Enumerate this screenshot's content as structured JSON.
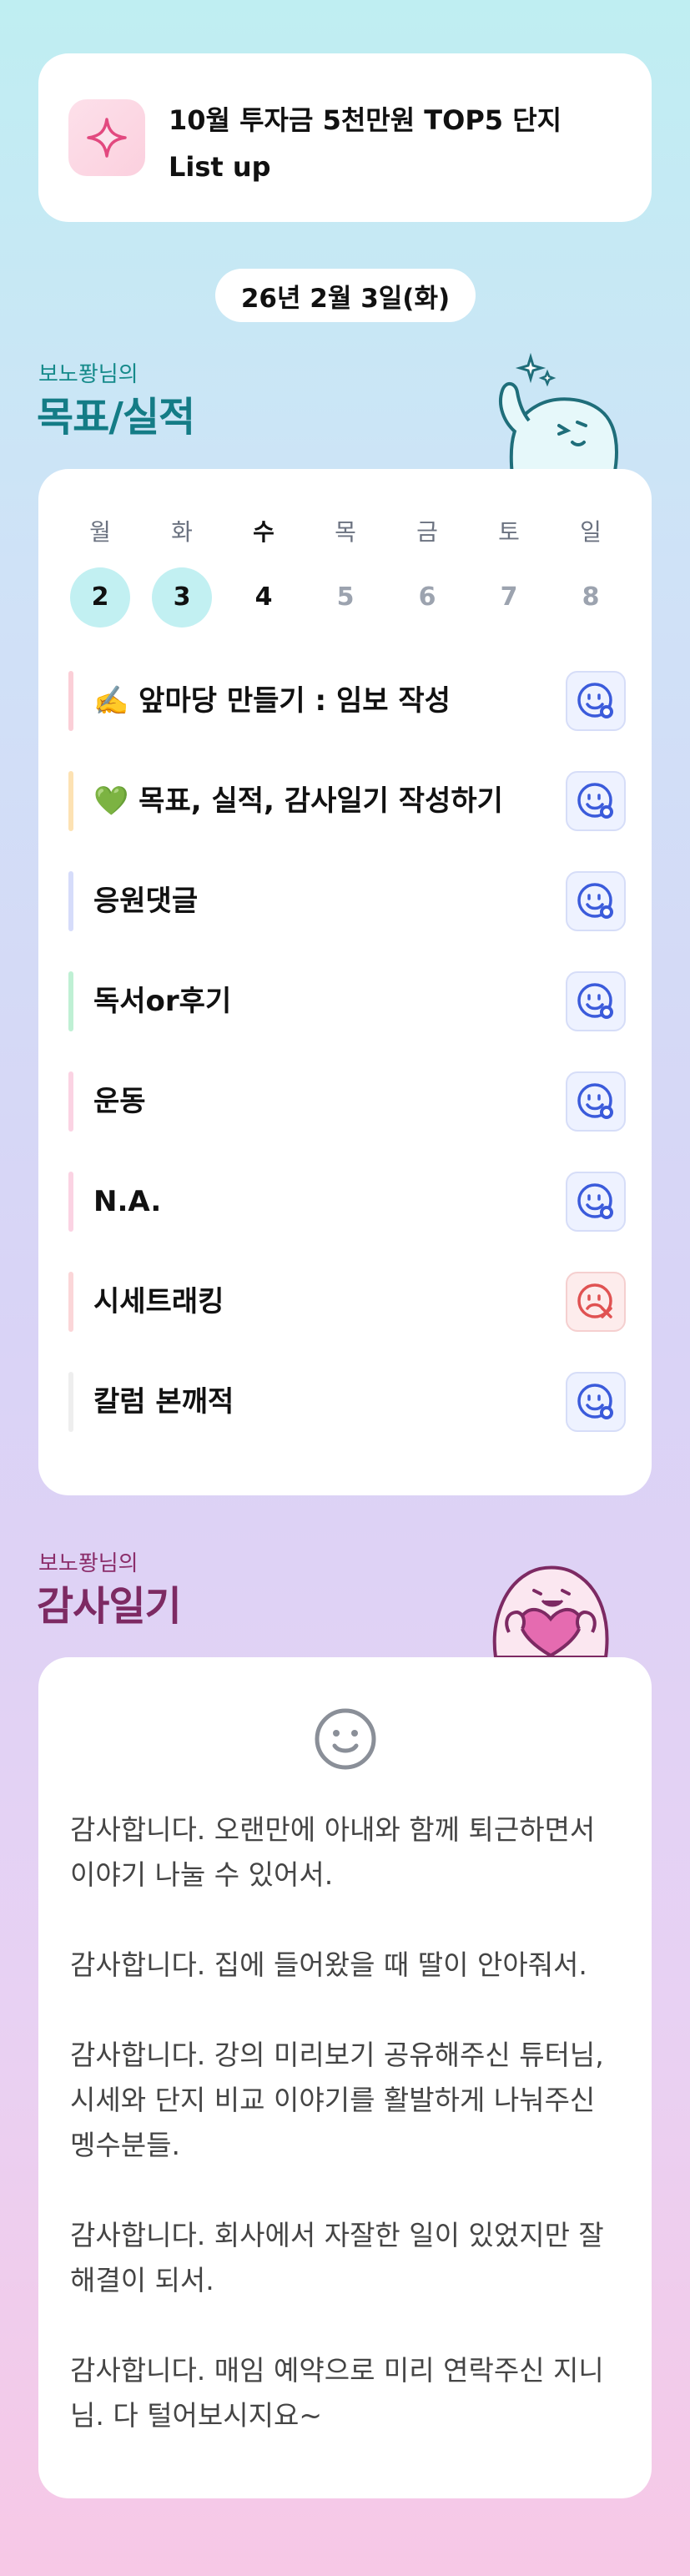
{
  "banner": {
    "title": "10월 투자금 5천만원 TOP5 단지\nList up",
    "icon": "sparkle-icon"
  },
  "date": "26년 2월 3일(화)",
  "goals_section": {
    "subtitle": "보노퐝님의",
    "title": "목표/실적"
  },
  "week": [
    {
      "name": "월",
      "num": "2",
      "state": "done"
    },
    {
      "name": "화",
      "num": "3",
      "state": "done"
    },
    {
      "name": "수",
      "num": "4",
      "state": "today"
    },
    {
      "name": "목",
      "num": "5",
      "state": "future"
    },
    {
      "name": "금",
      "num": "6",
      "state": "future"
    },
    {
      "name": "토",
      "num": "7",
      "state": "future"
    },
    {
      "name": "일",
      "num": "8",
      "state": "future"
    }
  ],
  "tasks": [
    {
      "label": "✍️ 앞마당 만들기 : 임보 작성",
      "bar_color": "#fbcfd7",
      "status": "ok"
    },
    {
      "label": "💚 목표, 실적, 감사일기 작성하기",
      "bar_color": "#fde2b3",
      "status": "ok"
    },
    {
      "label": "응원댓글",
      "bar_color": "#d6dcfa",
      "status": "ok"
    },
    {
      "label": "독서or후기",
      "bar_color": "#bff0d4",
      "status": "ok"
    },
    {
      "label": "운동",
      "bar_color": "#fbd3e3",
      "status": "ok"
    },
    {
      "label": "N.A.",
      "bar_color": "#fbd3e3",
      "status": "ok"
    },
    {
      "label": "시세트래킹",
      "bar_color": "#fbd6d8",
      "status": "fail"
    },
    {
      "label": "칼럼 본깨적",
      "bar_color": "#eeeeee",
      "status": "ok"
    }
  ],
  "thanks_section": {
    "subtitle": "보노퐝님의",
    "title": "감사일기"
  },
  "thanks_entries": [
    "감사합니다. 오랜만에 아내와 함께 퇴근하면서 이야기 나눌 수 있어서.",
    "감사합니다. 집에 들어왔을 때 딸이 안아줘서.",
    "감사합니다. 강의 미리보기 공유해주신 튜터님, 시세와 단지 비교 이야기를 활발하게 나눠주신 멩수분들.",
    "감사합니다. 회사에서 자잘한 일이 있었지만 잘 해결이 되서.",
    "감사합니다. 매임 예약으로 미리 연락주신 지니님. 다 털어보시지요~"
  ],
  "colors": {
    "accent_blue": "#3b5bdb",
    "fail_red": "#e05252",
    "teal": "#147c86",
    "plum": "#7d2a63"
  }
}
